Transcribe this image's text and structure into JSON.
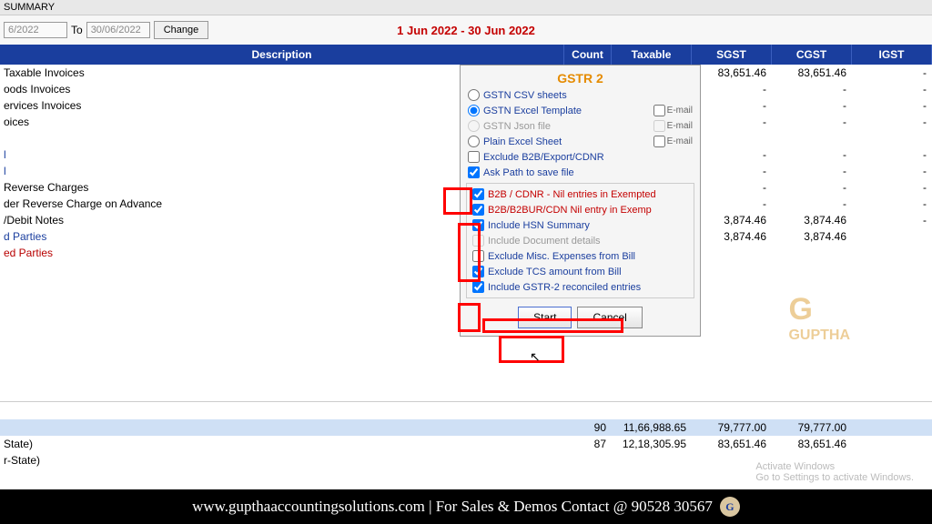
{
  "topbar": {
    "title": "SUMMARY"
  },
  "dates": {
    "from_value": "6/2022",
    "to_label": "To",
    "to_value": "30/06/2022",
    "change": "Change",
    "period": "1 Jun 2022 - 30 Jun 2022"
  },
  "headers": {
    "desc": "Description",
    "count": "Count",
    "taxable": "Taxable",
    "sgst": "SGST",
    "cgst": "CGST",
    "igst": "IGST"
  },
  "rows": [
    {
      "desc": " Taxable Invoices",
      "count": "",
      "taxable": "",
      "sgst": "83,651.46",
      "cgst": "83,651.46",
      "igst": "-",
      "cls": ""
    },
    {
      "desc": "oods Invoices",
      "count": "",
      "taxable": "",
      "sgst": "-",
      "cgst": "-",
      "igst": "-",
      "cls": ""
    },
    {
      "desc": "ervices Invoices",
      "count": "",
      "taxable": "",
      "sgst": "-",
      "cgst": "-",
      "igst": "-",
      "cls": ""
    },
    {
      "desc": "oices",
      "count": "",
      "taxable": "",
      "sgst": "-",
      "cgst": "-",
      "igst": "-",
      "cls": ""
    },
    {
      "desc": "",
      "count": "",
      "taxable": "",
      "sgst": "",
      "cgst": "",
      "igst": "",
      "cls": ""
    },
    {
      "desc": "l",
      "count": "",
      "taxable": "",
      "sgst": "-",
      "cgst": "-",
      "igst": "-",
      "cls": "blue"
    },
    {
      "desc": "l",
      "count": "",
      "taxable": "",
      "sgst": "-",
      "cgst": "-",
      "igst": "-",
      "cls": "blue"
    },
    {
      "desc": " Reverse Charges",
      "count": "",
      "taxable": "",
      "sgst": "-",
      "cgst": "-",
      "igst": "-",
      "cls": ""
    },
    {
      "desc": "der Reverse Charge on Advance",
      "count": "",
      "taxable": "",
      "sgst": "-",
      "cgst": "-",
      "igst": "-",
      "cls": ""
    },
    {
      "desc": "/Debit Notes",
      "count": "",
      "taxable": "",
      "sgst": "3,874.46",
      "cgst": "3,874.46",
      "igst": "-",
      "cls": ""
    },
    {
      "desc": "d Parties",
      "count": "",
      "taxable": "",
      "sgst": "3,874.46",
      "cgst": "3,874.46",
      "igst": "",
      "cls": "blue"
    },
    {
      "desc": "ed Parties",
      "count": "",
      "taxable": "",
      "sgst": "",
      "cgst": "",
      "igst": "",
      "cls": "red"
    }
  ],
  "dialog": {
    "title": "GSTR 2",
    "opt_csv": "GSTN CSV sheets",
    "opt_excel": "GSTN Excel Template",
    "opt_json": "GSTN Json file",
    "opt_plain": "Plain Excel Sheet",
    "email": "E-mail",
    "chk_exclude_b2b": "Exclude B2B/Export/CDNR",
    "chk_ask_path": "Ask Path to save file",
    "chk_b2b_nil": "B2B / CDNR - Nil entries in Exempted",
    "chk_b2bur_nil": "B2B/B2BUR/CDN Nil entry in Exemp",
    "chk_hsn": "Include HSN Summary",
    "chk_doc": "Include Document details",
    "chk_misc": "Exclude Misc. Expenses from Bill",
    "chk_tcs": "Exclude TCS amount from Bill",
    "chk_recon": "Include GSTR-2 reconciled entries",
    "start": "Start",
    "cancel": "Cancel"
  },
  "summary": [
    {
      "desc": "",
      "count": "90",
      "taxable": "11,66,988.65",
      "sgst": "79,777.00",
      "cgst": "79,777.00",
      "cls": "blue"
    },
    {
      "desc": "State)",
      "count": "87",
      "taxable": "12,18,305.95",
      "sgst": "83,651.46",
      "cgst": "83,651.46",
      "cls": ""
    },
    {
      "desc": "r-State)",
      "count": "",
      "taxable": "",
      "sgst": "",
      "cgst": "",
      "cls": ""
    }
  ],
  "watermark": {
    "g": "G",
    "text": "GUPTHA"
  },
  "activate": {
    "l1": "Activate Windows",
    "l2": "Go to Settings to activate Windows."
  },
  "banner": "www.gupthaaccountingsolutions.com | For Sales & Demos Contact @ 90528 30567"
}
